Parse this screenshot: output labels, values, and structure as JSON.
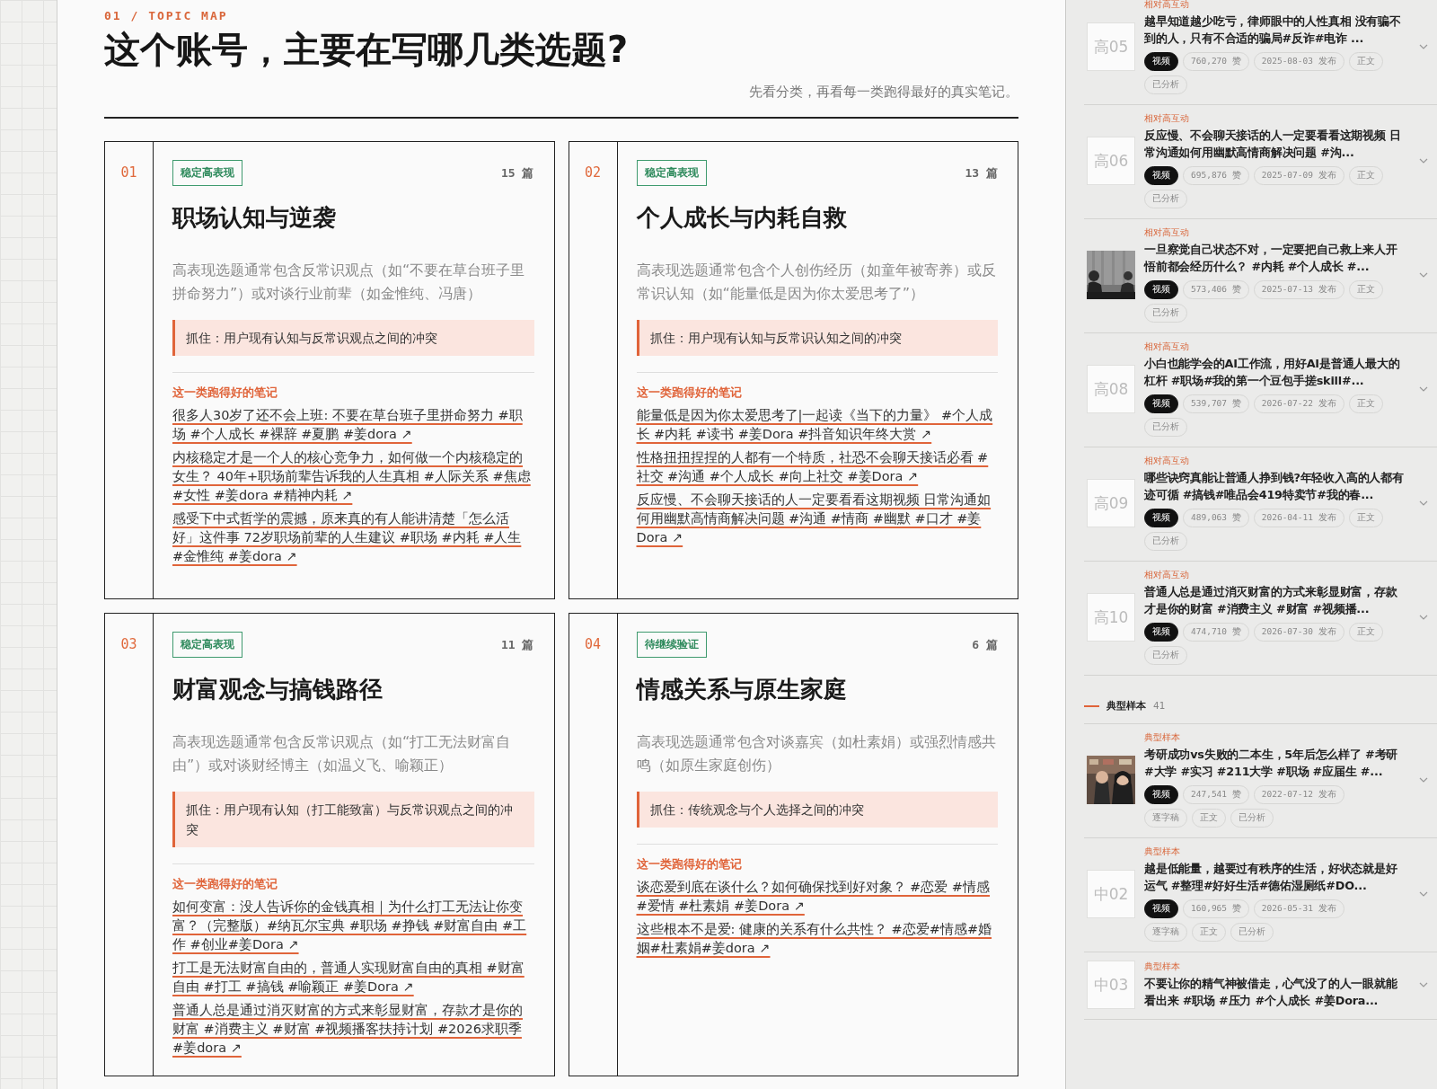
{
  "header": {
    "eyebrow": "01 / TOPIC MAP",
    "title": "这个账号，主要在写哪几类选题?",
    "subtitle": "先看分类，再看每一类跑得最好的真实笔记。"
  },
  "topics": [
    {
      "index": "01",
      "badge": "稳定高表现",
      "count": "15 篇",
      "title": "职场认知与逆袭",
      "description": "高表现选题通常包含反常识观点（如“不要在草台班子里拼命努力”）或对谈行业前辈（如金惟纯、冯唐）",
      "hook": "抓住：用户现有认知与反常识观点之间的冲突",
      "notes_label": "这一类跑得好的笔记",
      "notes": [
        "很多人30岁了还不会上班: 不要在草台班子里拼命努力 #职场 #个人成长 #裸辞 #夏鹏 #姜dora ↗",
        "内核稳定才是一个人的核心竞争力，如何做一个内核稳定的女生？ 40年+职场前辈告诉我的人生真相 #人际关系 #焦虑 #女性 #姜dora #精神内耗 ↗",
        "感受下中式哲学的震撼，原来真的有人能讲清楚「怎么活好」这件事 72岁职场前辈的人生建议 #职场 #内耗 #人生 #金惟纯 #姜dora ↗"
      ]
    },
    {
      "index": "02",
      "badge": "稳定高表现",
      "count": "13 篇",
      "title": "个人成长与内耗自救",
      "description": "高表现选题通常包含个人创伤经历（如童年被寄养）或反常识认知（如“能量低是因为你太爱思考了”）",
      "hook": "抓住：用户现有认知与反常识认知之间的冲突",
      "notes_label": "这一类跑得好的笔记",
      "notes": [
        "能量低是因为你太爱思考了|一起读《当下的力量》 #个人成长 #内耗 #读书 #姜Dora #抖音知识年终大赏 ↗",
        "性格扭扭捏捏的人都有一个特质，社恐不会聊天接话必看 #社交 #沟通 #个人成长 #向上社交 #姜Dora ↗",
        "反应慢、不会聊天接话的人一定要看看这期视频 日常沟通如何用幽默高情商解决问题 #沟通 #情商 #幽默 #口才 #姜Dora ↗"
      ]
    },
    {
      "index": "03",
      "badge": "稳定高表现",
      "count": "11 篇",
      "title": "财富观念与搞钱路径",
      "description": "高表现选题通常包含反常识观点（如“打工无法财富自由”）或对谈财经博主（如温义飞、喻颖正）",
      "hook": "抓住：用户现有认知（打工能致富）与反常识观点之间的冲突",
      "notes_label": "这一类跑得好的笔记",
      "notes": [
        "如何变富：没人告诉你的金钱真相｜为什么打工无法让你变富？（完整版）#纳瓦尔宝典 #职场 #挣钱 #财富自由 #工作 #创业#姜Dora ↗",
        "打工是无法财富自由的，普通人实现财富自由的真相 #财富自由 #打工 #搞钱 #喻颖正 #姜Dora ↗",
        "普通人总是通过消灭财富的方式来彰显财富，存款才是你的财富 #消费主义 #财富 #视频播客扶持计划 #2026求职季 #姜dora ↗"
      ]
    },
    {
      "index": "04",
      "badge": "待继续验证",
      "count": "6 篇",
      "title": "情感关系与原生家庭",
      "description": "高表现选题通常包含对谈嘉宾（如杜素娟）或强烈情感共鸣（如原生家庭创伤）",
      "hook": "抓住：传统观念与个人选择之间的冲突",
      "notes_label": "这一类跑得好的笔记",
      "notes": [
        "谈恋爱到底在谈什么？如何确保找到好对象？ #恋爱 #情感 #爱情 #杜素娟 #姜Dora ↗",
        "这些根本不是爱: 健康的关系有什么共性？ #恋爱#情感#婚姻#杜素娟#姜dora ↗"
      ]
    }
  ],
  "sidebar": [
    {
      "kind": "item",
      "tier": "相对高互动",
      "thumb": {
        "kind": "label",
        "text": "高05"
      },
      "title": "越早知道越少吃亏，律师眼中的人性真相 没有骗不到的人，只有不合适的骗局#反诈#电诈 ...",
      "pills": [
        {
          "kind": "type",
          "text": "视频"
        },
        {
          "kind": "meta",
          "text": "760,270 赞"
        },
        {
          "kind": "meta",
          "text": "2025-08-03 发布"
        },
        {
          "kind": "meta",
          "text": "正文"
        },
        {
          "kind": "meta",
          "text": "已分析"
        }
      ]
    },
    {
      "kind": "item",
      "tier": "相对高互动",
      "thumb": {
        "kind": "label",
        "text": "高06"
      },
      "title": "反应慢、不会聊天接话的人一定要看看这期视频 日常沟通如何用幽默高情商解决问题 #沟...",
      "pills": [
        {
          "kind": "type",
          "text": "视频"
        },
        {
          "kind": "meta",
          "text": "695,876 赞"
        },
        {
          "kind": "meta",
          "text": "2025-07-09 发布"
        },
        {
          "kind": "meta",
          "text": "正文"
        },
        {
          "kind": "meta",
          "text": "已分析"
        }
      ]
    },
    {
      "kind": "item",
      "tier": "相对高互动",
      "thumb": {
        "kind": "picture"
      },
      "title": "一旦察觉自己状态不对，一定要把自己救上来人开悟前都会经历什么？ #内耗 #个人成长 #...",
      "pills": [
        {
          "kind": "type",
          "text": "视频"
        },
        {
          "kind": "meta",
          "text": "573,406 赞"
        },
        {
          "kind": "meta",
          "text": "2025-07-13 发布"
        },
        {
          "kind": "meta",
          "text": "正文"
        },
        {
          "kind": "meta",
          "text": "已分析"
        }
      ]
    },
    {
      "kind": "item",
      "tier": "相对高互动",
      "thumb": {
        "kind": "label",
        "text": "高08"
      },
      "title": "小白也能学会的AI工作流，用好AI是普通人最大的杠杆 #职场#我的第一个豆包手搓skill#...",
      "pills": [
        {
          "kind": "type",
          "text": "视频"
        },
        {
          "kind": "meta",
          "text": "539,707 赞"
        },
        {
          "kind": "meta",
          "text": "2026-07-22 发布"
        },
        {
          "kind": "meta",
          "text": "正文"
        },
        {
          "kind": "meta",
          "text": "已分析"
        }
      ]
    },
    {
      "kind": "item",
      "tier": "相对高互动",
      "thumb": {
        "kind": "label",
        "text": "高09"
      },
      "title": "哪些诀窍真能让普通人挣到钱?年轻收入高的人都有迹可循 #搞钱#唯品会419特卖节#我的春...",
      "pills": [
        {
          "kind": "type",
          "text": "视频"
        },
        {
          "kind": "meta",
          "text": "489,063 赞"
        },
        {
          "kind": "meta",
          "text": "2026-04-11 发布"
        },
        {
          "kind": "meta",
          "text": "正文"
        },
        {
          "kind": "meta",
          "text": "已分析"
        }
      ]
    },
    {
      "kind": "item",
      "tier": "相对高互动",
      "thumb": {
        "kind": "label",
        "text": "高10"
      },
      "title": "普通人总是通过消灭财富的方式来彰显财富，存款才是你的财富 #消费主义 #财富 #视频播...",
      "pills": [
        {
          "kind": "type",
          "text": "视频"
        },
        {
          "kind": "meta",
          "text": "474,710 赞"
        },
        {
          "kind": "meta",
          "text": "2026-07-30 发布"
        },
        {
          "kind": "meta",
          "text": "正文"
        },
        {
          "kind": "meta",
          "text": "已分析"
        }
      ]
    },
    {
      "kind": "section",
      "label": "典型样本",
      "count": "41"
    },
    {
      "kind": "item",
      "tier": "典型样本",
      "thumb": {
        "kind": "picture"
      },
      "title": "考研成功vs失败的二本生，5年后怎么样了 #考研 #大学 #实习 #211大学 #职场 #应届生 #...",
      "pills": [
        {
          "kind": "type",
          "text": "视频"
        },
        {
          "kind": "meta",
          "text": "247,541 赞"
        },
        {
          "kind": "meta",
          "text": "2022-07-12 发布"
        },
        {
          "kind": "meta",
          "text": "逐字稿"
        },
        {
          "kind": "meta",
          "text": "正文"
        },
        {
          "kind": "meta",
          "text": "已分析"
        }
      ]
    },
    {
      "kind": "item",
      "tier": "典型样本",
      "thumb": {
        "kind": "label",
        "text": "中02"
      },
      "title": "越是低能量，越要过有秩序的生活，好状态就是好运气 #整理#好好生活#德佑湿厕纸#DO...",
      "pills": [
        {
          "kind": "type",
          "text": "视频"
        },
        {
          "kind": "meta",
          "text": "160,965 赞"
        },
        {
          "kind": "meta",
          "text": "2026-05-31 发布"
        },
        {
          "kind": "meta",
          "text": "逐字稿"
        },
        {
          "kind": "meta",
          "text": "正文"
        },
        {
          "kind": "meta",
          "text": "已分析"
        }
      ]
    },
    {
      "kind": "item",
      "tier": "典型样本",
      "thumb": {
        "kind": "label",
        "text": "中03"
      },
      "title": "不要让你的精气神被借走，心气没了的人一眼就能看出来 #职场 #压力 #个人成长 #姜Dora..."
    }
  ]
}
